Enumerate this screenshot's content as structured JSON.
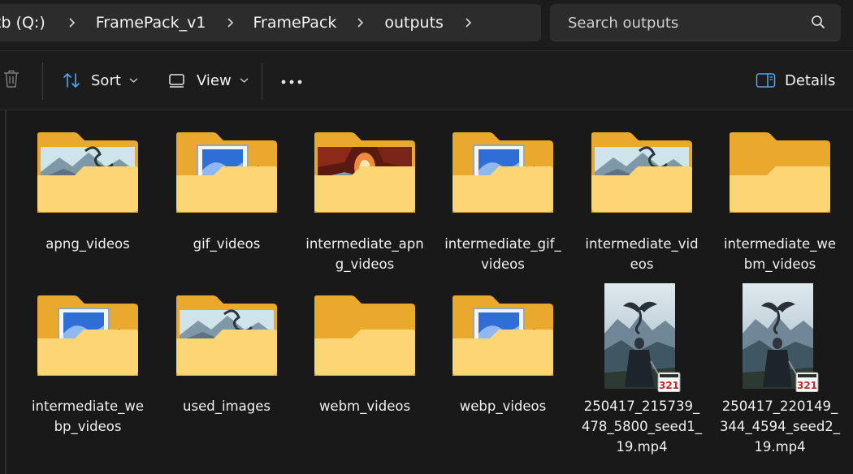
{
  "breadcrumb": {
    "items": [
      "tb (Q:)",
      "FramePack_v1",
      "FramePack",
      "outputs"
    ]
  },
  "search": {
    "placeholder": "Search outputs"
  },
  "toolbar": {
    "sort_label": "Sort",
    "view_label": "View",
    "details_label": "Details"
  },
  "items": [
    {
      "label": "apng_videos",
      "type": "folder",
      "preview": "mountain"
    },
    {
      "label": "gif_videos",
      "type": "folder",
      "preview": "picture"
    },
    {
      "label": "intermediate_apn\ng_videos",
      "type": "folder",
      "preview": "fire"
    },
    {
      "label": "intermediate_gif_\nvideos",
      "type": "folder",
      "preview": "picture"
    },
    {
      "label": "intermediate_vid\neos",
      "type": "folder",
      "preview": "mountain"
    },
    {
      "label": "intermediate_we\nbm_videos",
      "type": "folder",
      "preview": "empty"
    },
    {
      "label": "intermediate_we\nbp_videos",
      "type": "folder",
      "preview": "picture"
    },
    {
      "label": "used_images",
      "type": "folder",
      "preview": "mountain"
    },
    {
      "label": "webm_videos",
      "type": "folder",
      "preview": "empty"
    },
    {
      "label": "webp_videos",
      "type": "folder",
      "preview": "picture"
    },
    {
      "label": "250417_215739_\n478_5800_seed1_\n19.mp4",
      "type": "video",
      "badge": "321"
    },
    {
      "label": "250417_220149_\n344_4594_seed2_\n19.mp4",
      "type": "video",
      "badge": "321"
    }
  ],
  "colors": {
    "folder_back": "#e8a92c",
    "folder_front": "#fcd675",
    "background": "#191919"
  }
}
